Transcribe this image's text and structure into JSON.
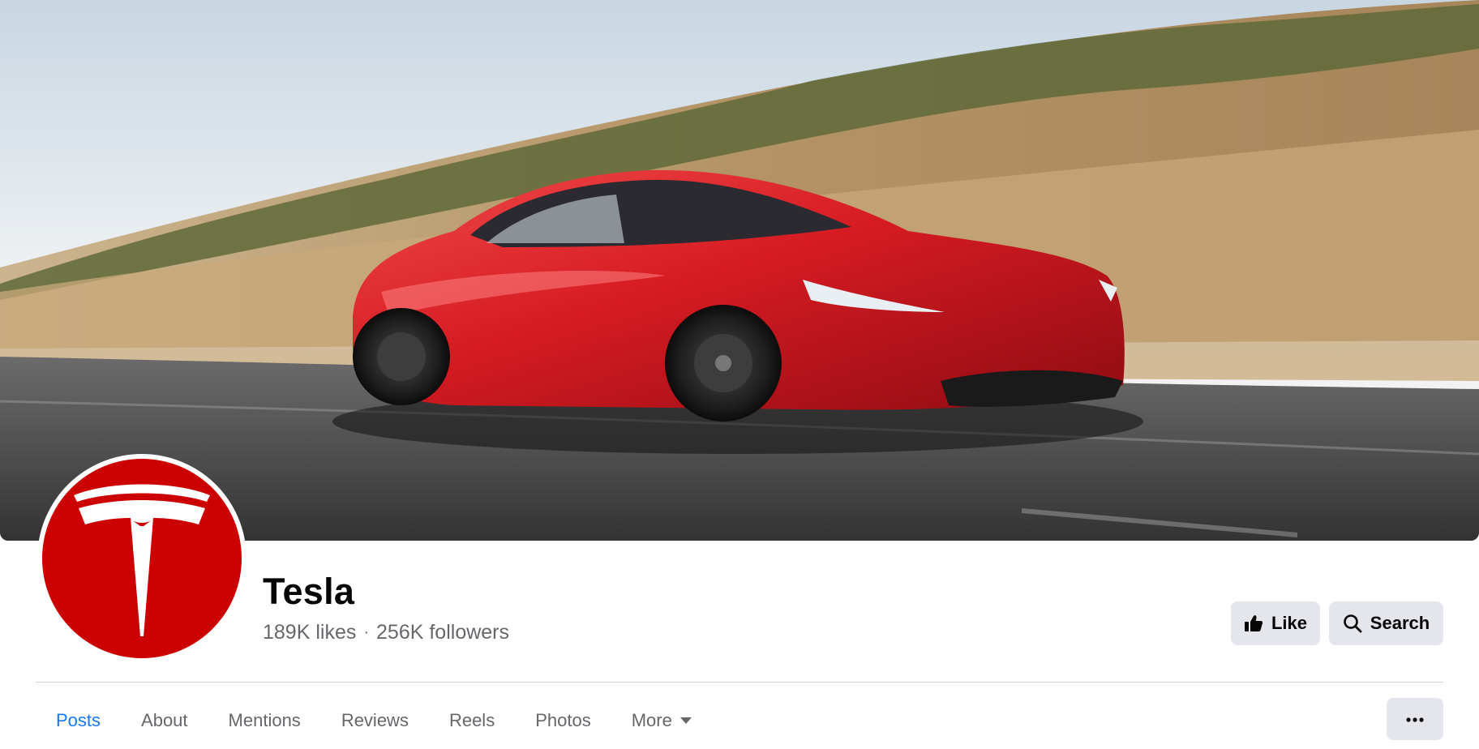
{
  "page": {
    "name": "Tesla",
    "likes": "189K likes",
    "separator": "·",
    "followers": "256K followers"
  },
  "cover": {
    "description_icon": "roadster-photo"
  },
  "actions": {
    "like_label": "Like",
    "search_label": "Search"
  },
  "tabs": [
    {
      "label": "Posts",
      "active": true
    },
    {
      "label": "About",
      "active": false
    },
    {
      "label": "Mentions",
      "active": false
    },
    {
      "label": "Reviews",
      "active": false
    },
    {
      "label": "Reels",
      "active": false
    },
    {
      "label": "Photos",
      "active": false
    },
    {
      "label": "More",
      "active": false
    }
  ],
  "colors": {
    "accent": "#1877f2",
    "brand_red": "#cc0000",
    "button_bg": "#e4e6eb",
    "secondary_text": "#65676b"
  },
  "icons": {
    "like": "thumbs-up-icon",
    "search": "search-icon",
    "more": "caret-down-icon",
    "overflow": "ellipsis-icon"
  }
}
